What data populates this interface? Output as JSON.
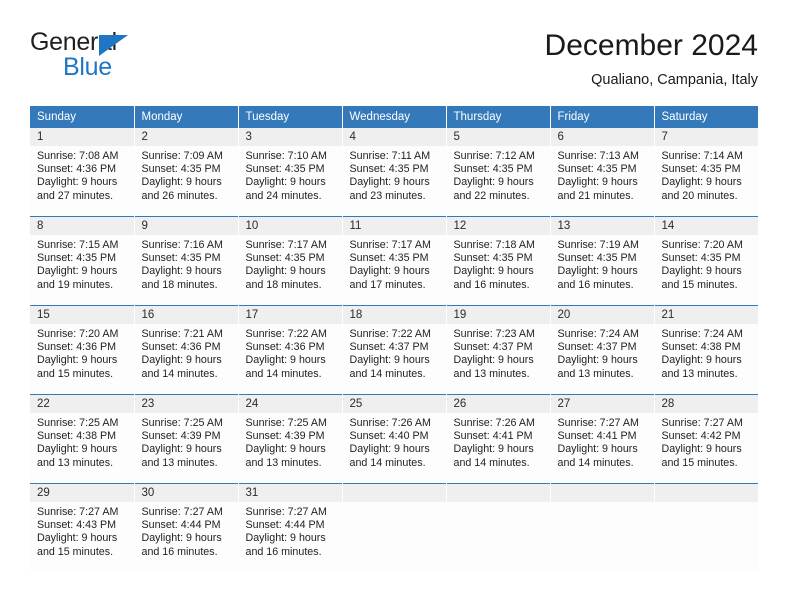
{
  "logo": {
    "word_top": "General",
    "word_bottom": "Blue",
    "triangle_color": "#1f76c4",
    "icon": "triangle-icon"
  },
  "header": {
    "title": "December 2024",
    "subtitle": "Qualiano, Campania, Italy"
  },
  "theme": {
    "header_blue": "#3479BA",
    "daynum_gray": "#EFEFEF",
    "logo_blue": "#1F76C4"
  },
  "calendar": {
    "weekday_headers": [
      "Sunday",
      "Monday",
      "Tuesday",
      "Wednesday",
      "Thursday",
      "Friday",
      "Saturday"
    ],
    "weeks": [
      [
        {
          "day": "1",
          "sunrise": "Sunrise: 7:08 AM",
          "sunset": "Sunset: 4:36 PM",
          "daylight1": "Daylight: 9 hours",
          "daylight2": "and 27 minutes."
        },
        {
          "day": "2",
          "sunrise": "Sunrise: 7:09 AM",
          "sunset": "Sunset: 4:35 PM",
          "daylight1": "Daylight: 9 hours",
          "daylight2": "and 26 minutes."
        },
        {
          "day": "3",
          "sunrise": "Sunrise: 7:10 AM",
          "sunset": "Sunset: 4:35 PM",
          "daylight1": "Daylight: 9 hours",
          "daylight2": "and 24 minutes."
        },
        {
          "day": "4",
          "sunrise": "Sunrise: 7:11 AM",
          "sunset": "Sunset: 4:35 PM",
          "daylight1": "Daylight: 9 hours",
          "daylight2": "and 23 minutes."
        },
        {
          "day": "5",
          "sunrise": "Sunrise: 7:12 AM",
          "sunset": "Sunset: 4:35 PM",
          "daylight1": "Daylight: 9 hours",
          "daylight2": "and 22 minutes."
        },
        {
          "day": "6",
          "sunrise": "Sunrise: 7:13 AM",
          "sunset": "Sunset: 4:35 PM",
          "daylight1": "Daylight: 9 hours",
          "daylight2": "and 21 minutes."
        },
        {
          "day": "7",
          "sunrise": "Sunrise: 7:14 AM",
          "sunset": "Sunset: 4:35 PM",
          "daylight1": "Daylight: 9 hours",
          "daylight2": "and 20 minutes."
        }
      ],
      [
        {
          "day": "8",
          "sunrise": "Sunrise: 7:15 AM",
          "sunset": "Sunset: 4:35 PM",
          "daylight1": "Daylight: 9 hours",
          "daylight2": "and 19 minutes."
        },
        {
          "day": "9",
          "sunrise": "Sunrise: 7:16 AM",
          "sunset": "Sunset: 4:35 PM",
          "daylight1": "Daylight: 9 hours",
          "daylight2": "and 18 minutes."
        },
        {
          "day": "10",
          "sunrise": "Sunrise: 7:17 AM",
          "sunset": "Sunset: 4:35 PM",
          "daylight1": "Daylight: 9 hours",
          "daylight2": "and 18 minutes."
        },
        {
          "day": "11",
          "sunrise": "Sunrise: 7:17 AM",
          "sunset": "Sunset: 4:35 PM",
          "daylight1": "Daylight: 9 hours",
          "daylight2": "and 17 minutes."
        },
        {
          "day": "12",
          "sunrise": "Sunrise: 7:18 AM",
          "sunset": "Sunset: 4:35 PM",
          "daylight1": "Daylight: 9 hours",
          "daylight2": "and 16 minutes."
        },
        {
          "day": "13",
          "sunrise": "Sunrise: 7:19 AM",
          "sunset": "Sunset: 4:35 PM",
          "daylight1": "Daylight: 9 hours",
          "daylight2": "and 16 minutes."
        },
        {
          "day": "14",
          "sunrise": "Sunrise: 7:20 AM",
          "sunset": "Sunset: 4:35 PM",
          "daylight1": "Daylight: 9 hours",
          "daylight2": "and 15 minutes."
        }
      ],
      [
        {
          "day": "15",
          "sunrise": "Sunrise: 7:20 AM",
          "sunset": "Sunset: 4:36 PM",
          "daylight1": "Daylight: 9 hours",
          "daylight2": "and 15 minutes."
        },
        {
          "day": "16",
          "sunrise": "Sunrise: 7:21 AM",
          "sunset": "Sunset: 4:36 PM",
          "daylight1": "Daylight: 9 hours",
          "daylight2": "and 14 minutes."
        },
        {
          "day": "17",
          "sunrise": "Sunrise: 7:22 AM",
          "sunset": "Sunset: 4:36 PM",
          "daylight1": "Daylight: 9 hours",
          "daylight2": "and 14 minutes."
        },
        {
          "day": "18",
          "sunrise": "Sunrise: 7:22 AM",
          "sunset": "Sunset: 4:37 PM",
          "daylight1": "Daylight: 9 hours",
          "daylight2": "and 14 minutes."
        },
        {
          "day": "19",
          "sunrise": "Sunrise: 7:23 AM",
          "sunset": "Sunset: 4:37 PM",
          "daylight1": "Daylight: 9 hours",
          "daylight2": "and 13 minutes."
        },
        {
          "day": "20",
          "sunrise": "Sunrise: 7:24 AM",
          "sunset": "Sunset: 4:37 PM",
          "daylight1": "Daylight: 9 hours",
          "daylight2": "and 13 minutes."
        },
        {
          "day": "21",
          "sunrise": "Sunrise: 7:24 AM",
          "sunset": "Sunset: 4:38 PM",
          "daylight1": "Daylight: 9 hours",
          "daylight2": "and 13 minutes."
        }
      ],
      [
        {
          "day": "22",
          "sunrise": "Sunrise: 7:25 AM",
          "sunset": "Sunset: 4:38 PM",
          "daylight1": "Daylight: 9 hours",
          "daylight2": "and 13 minutes."
        },
        {
          "day": "23",
          "sunrise": "Sunrise: 7:25 AM",
          "sunset": "Sunset: 4:39 PM",
          "daylight1": "Daylight: 9 hours",
          "daylight2": "and 13 minutes."
        },
        {
          "day": "24",
          "sunrise": "Sunrise: 7:25 AM",
          "sunset": "Sunset: 4:39 PM",
          "daylight1": "Daylight: 9 hours",
          "daylight2": "and 13 minutes."
        },
        {
          "day": "25",
          "sunrise": "Sunrise: 7:26 AM",
          "sunset": "Sunset: 4:40 PM",
          "daylight1": "Daylight: 9 hours",
          "daylight2": "and 14 minutes."
        },
        {
          "day": "26",
          "sunrise": "Sunrise: 7:26 AM",
          "sunset": "Sunset: 4:41 PM",
          "daylight1": "Daylight: 9 hours",
          "daylight2": "and 14 minutes."
        },
        {
          "day": "27",
          "sunrise": "Sunrise: 7:27 AM",
          "sunset": "Sunset: 4:41 PM",
          "daylight1": "Daylight: 9 hours",
          "daylight2": "and 14 minutes."
        },
        {
          "day": "28",
          "sunrise": "Sunrise: 7:27 AM",
          "sunset": "Sunset: 4:42 PM",
          "daylight1": "Daylight: 9 hours",
          "daylight2": "and 15 minutes."
        }
      ],
      [
        {
          "day": "29",
          "sunrise": "Sunrise: 7:27 AM",
          "sunset": "Sunset: 4:43 PM",
          "daylight1": "Daylight: 9 hours",
          "daylight2": "and 15 minutes."
        },
        {
          "day": "30",
          "sunrise": "Sunrise: 7:27 AM",
          "sunset": "Sunset: 4:44 PM",
          "daylight1": "Daylight: 9 hours",
          "daylight2": "and 16 minutes."
        },
        {
          "day": "31",
          "sunrise": "Sunrise: 7:27 AM",
          "sunset": "Sunset: 4:44 PM",
          "daylight1": "Daylight: 9 hours",
          "daylight2": "and 16 minutes."
        },
        {
          "day": "",
          "sunrise": "",
          "sunset": "",
          "daylight1": "",
          "daylight2": ""
        },
        {
          "day": "",
          "sunrise": "",
          "sunset": "",
          "daylight1": "",
          "daylight2": ""
        },
        {
          "day": "",
          "sunrise": "",
          "sunset": "",
          "daylight1": "",
          "daylight2": ""
        },
        {
          "day": "",
          "sunrise": "",
          "sunset": "",
          "daylight1": "",
          "daylight2": ""
        }
      ]
    ]
  }
}
